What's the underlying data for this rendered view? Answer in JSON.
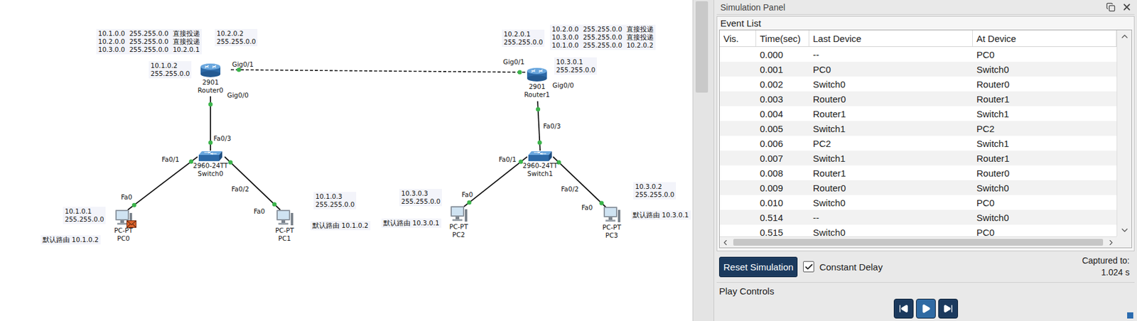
{
  "canvas": {
    "devices": [
      {
        "kind": "router",
        "model": "2901",
        "name": "Router0",
        "envelope": false
      },
      {
        "kind": "router",
        "model": "2901",
        "name": "Router1",
        "envelope": false
      },
      {
        "kind": "switch",
        "model": "2960-24TT",
        "name": "Switch0",
        "envelope": false
      },
      {
        "kind": "switch",
        "model": "2960-24TT",
        "name": "Switch1",
        "envelope": false
      },
      {
        "kind": "pc",
        "model": "PC-PT",
        "name": "PC0",
        "envelope": true
      },
      {
        "kind": "pc",
        "model": "PC-PT",
        "name": "PC1",
        "envelope": false
      },
      {
        "kind": "pc",
        "model": "PC-PT",
        "name": "PC2",
        "envelope": false
      },
      {
        "kind": "pc",
        "model": "PC-PT",
        "name": "PC3",
        "envelope": false
      }
    ],
    "links": [
      {
        "kind": "dashed",
        "up": true
      },
      {
        "kind": "solid",
        "up": true
      },
      {
        "kind": "solid",
        "up": true
      },
      {
        "kind": "solid",
        "up": true
      },
      {
        "kind": "solid",
        "up": true
      },
      {
        "kind": "solid",
        "up": true
      },
      {
        "kind": "solid",
        "up": true
      }
    ],
    "port_labels": [
      "Gig0/1",
      "Gig0/0",
      "Gig0/1",
      "Gig0/0",
      "Fa0/3",
      "Fa0/1",
      "Fa0/2",
      "Fa0/3",
      "Fa0/1",
      "Fa0/2",
      "Fa0",
      "Fa0",
      "Fa0",
      "Fa0"
    ],
    "annotations": [
      {
        "kind": "route_table",
        "rows": [
          [
            "10.1.0.0",
            "255.255.0.0",
            "直接投递"
          ],
          [
            "10.2.0.0",
            "255.255.0.0",
            "直接投递"
          ],
          [
            "10.3.0.0",
            "255.255.0.0",
            "10.2.0.1"
          ]
        ]
      },
      {
        "kind": "address",
        "lines": [
          "10.2.0.2",
          "255.255.0.0"
        ]
      },
      {
        "kind": "address",
        "lines": [
          "10.1.0.2",
          "255.255.0.0"
        ]
      },
      {
        "kind": "route_table",
        "rows": [
          [
            "10.2.0.0",
            "255.255.0.0",
            "直接投递"
          ],
          [
            "10.3.0.0",
            "255.255.0.0",
            "直接投递"
          ],
          [
            "10.1.0.0",
            "255.255.0.0",
            "10.2.0.2"
          ]
        ]
      },
      {
        "kind": "address",
        "lines": [
          "10.2.0.1",
          "255.255.0.0"
        ]
      },
      {
        "kind": "address",
        "lines": [
          "10.3.0.1",
          "255.255.0.0"
        ]
      },
      {
        "kind": "address",
        "lines": [
          "10.1.0.1",
          "255.255.0.0"
        ]
      },
      {
        "kind": "address",
        "lines": [
          "默认路由 10.1.0.2"
        ]
      },
      {
        "kind": "address",
        "lines": [
          "10.1.0.3",
          "255.255.0.0"
        ]
      },
      {
        "kind": "address",
        "lines": [
          "默认路由 10.1.0.2"
        ]
      },
      {
        "kind": "address",
        "lines": [
          "10.3.0.3",
          "255.255.0.0"
        ]
      },
      {
        "kind": "address",
        "lines": [
          "默认路由 10.3.0.1"
        ]
      },
      {
        "kind": "address",
        "lines": [
          "10.3.0.2",
          "255.255.0.0"
        ]
      },
      {
        "kind": "address",
        "lines": [
          "默认路由 10.3.0.1"
        ]
      }
    ]
  },
  "simulation_panel": {
    "title": "Simulation Panel",
    "event_list": {
      "label": "Event List",
      "columns": [
        "Vis.",
        "Time(sec)",
        "Last Device",
        "At Device"
      ],
      "rows": [
        {
          "vis": "",
          "time": "0.000",
          "last": "--",
          "at": "PC0"
        },
        {
          "vis": "",
          "time": "0.001",
          "last": "PC0",
          "at": "Switch0"
        },
        {
          "vis": "",
          "time": "0.002",
          "last": "Switch0",
          "at": "Router0"
        },
        {
          "vis": "",
          "time": "0.003",
          "last": "Router0",
          "at": "Router1"
        },
        {
          "vis": "",
          "time": "0.004",
          "last": "Router1",
          "at": "Switch1"
        },
        {
          "vis": "",
          "time": "0.005",
          "last": "Switch1",
          "at": "PC2"
        },
        {
          "vis": "",
          "time": "0.006",
          "last": "PC2",
          "at": "Switch1"
        },
        {
          "vis": "",
          "time": "0.007",
          "last": "Switch1",
          "at": "Router1"
        },
        {
          "vis": "",
          "time": "0.008",
          "last": "Router1",
          "at": "Router0"
        },
        {
          "vis": "",
          "time": "0.009",
          "last": "Router0",
          "at": "Switch0"
        },
        {
          "vis": "",
          "time": "0.010",
          "last": "Switch0",
          "at": "PC0"
        },
        {
          "vis": "",
          "time": "0.514",
          "last": "--",
          "at": "Switch0"
        },
        {
          "vis": "",
          "time": "0.515",
          "last": "Switch0",
          "at": "PC0"
        }
      ]
    },
    "reset_button": "Reset Simulation",
    "constant_delay": {
      "label": "Constant Delay",
      "checked": true
    },
    "captured": {
      "label": "Captured to:",
      "value": "1.024 s"
    },
    "play_controls": {
      "label": "Play Controls",
      "buttons": [
        {
          "kind": "back",
          "active": false
        },
        {
          "kind": "play",
          "active": true
        },
        {
          "kind": "forward",
          "active": false
        }
      ]
    }
  }
}
